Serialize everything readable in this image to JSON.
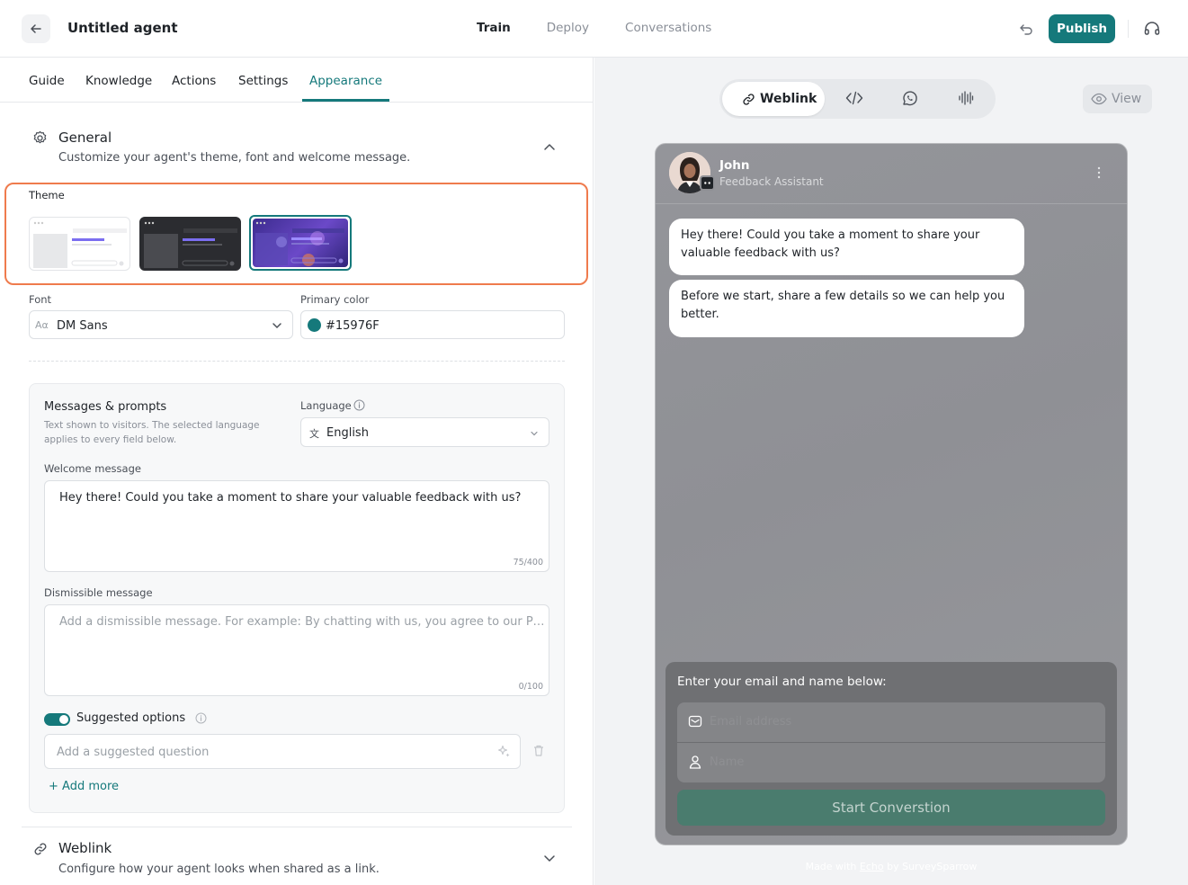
{
  "header": {
    "title": "Untitled agent",
    "tabs": [
      "Train",
      "Deploy",
      "Conversations"
    ],
    "active_tab": "Train",
    "publish_label": "Publish"
  },
  "colors": {
    "accent": "#15797B",
    "highlight_border": "#EF7B4D"
  },
  "sub_tabs": [
    "Guide",
    "Knowledge",
    "Actions",
    "Settings",
    "Appearance"
  ],
  "active_sub_tab": "Appearance",
  "general": {
    "title": "General",
    "subtitle": "Customize your agent's theme, font and welcome message.",
    "theme_label": "Theme",
    "font_label": "Font",
    "font_value": "DM Sans",
    "primary_color_label": "Primary color",
    "primary_color_value": "#15976F"
  },
  "messages": {
    "title": "Messages & prompts",
    "subtitle": "Text shown to visitors. The selected language applies to every field below.",
    "language_label": "Language",
    "language_value": "English",
    "welcome_label": "Welcome message",
    "welcome_value": "Hey there! Could you take a moment to share your valuable feedback with us?",
    "welcome_count": "75/400",
    "dismissible_label": "Dismissible message",
    "dismissible_placeholder": "Add a dismissible message. For example: By chatting with us, you agree to our Pr...",
    "dismissible_count": "0/100",
    "suggested_label": "Suggested options",
    "suggested_placeholder": "Add a suggested question",
    "add_more": "+ Add more"
  },
  "weblink_section": {
    "title": "Weblink",
    "subtitle": "Configure how your agent looks when shared as a link."
  },
  "preview": {
    "channel_active": "Weblink",
    "view_label": "View",
    "agent_name": "John",
    "agent_role": "Feedback Assistant",
    "bubbles": [
      "Hey there! Could you take a moment to share your valuable feedback with us?",
      "Before we start, share a few details so we can help you better."
    ],
    "form_title": "Enter your email and name below:",
    "email_placeholder": "Email address",
    "name_placeholder": "Name",
    "start_button": "Start Converstion",
    "footer_prefix": "Made with",
    "footer_brand": "Echo",
    "footer_suffix": "by SurveySparrow"
  }
}
